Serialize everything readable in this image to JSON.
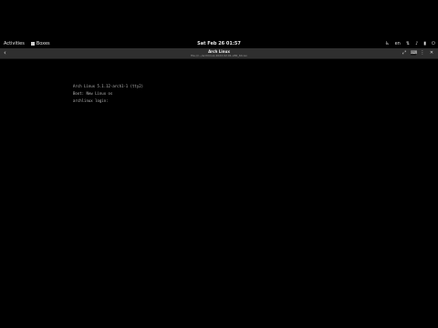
{
  "topbar": {
    "activities_label": "Activities",
    "app_label": "Boxes",
    "clock": "Sat Feb 26 01:57",
    "tray_icons": [
      "accessibility-icon",
      "keyboard-layout",
      "network-icon",
      "volume-icon",
      "battery-icon",
      "power-icon"
    ],
    "keyboard_layout": "en"
  },
  "headerbar": {
    "title": "Arch Linux",
    "subtitle": "file:///.../archlinux-2022.02.01-x86_64.iso",
    "actions": [
      "fullscreen-icon",
      "keyboard-icon",
      "menu-icon",
      "close-icon"
    ]
  },
  "console": {
    "lines": [
      "Arch Linux 5.1.12-arch1-1 (tty2)",
      "",
      "Boot: New Linux os",
      "",
      "archlinux login:"
    ]
  }
}
